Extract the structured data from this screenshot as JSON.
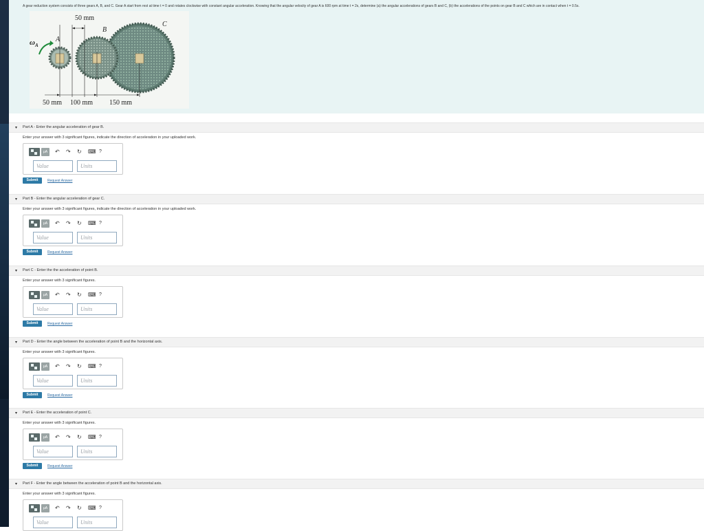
{
  "problem": {
    "text": "A gear reduction system consists of three gears A, B, and C. Gear A start from rest at time t = 0 and rotates clockwise with constant angular acceleration. Knowing that the angular velocity of gear A is 600 rpm at time t = 2s, determine (a) the angular accelerations of gears B and C, (b) the accelerations of the points on gear B and C which are in contact when t = 0.5s.",
    "figure": {
      "label_omega": "ω",
      "label_omega_sub": "A",
      "label_A": "A",
      "label_B": "B",
      "label_C": "C",
      "dim_top": "50 mm",
      "dim_bottom_1": "50 mm",
      "dim_bottom_2": "100 mm",
      "dim_bottom_3": "150 mm"
    }
  },
  "toolbar": {
    "mu_label": "μA",
    "undo_glyph": "↶",
    "redo_glyph": "↷",
    "reset_glyph": "↻",
    "help_glyph": "?"
  },
  "parts": [
    {
      "title": "Part A - Enter the angular acceleration of gear B.",
      "instructions": "Enter your answer with 3 significant figures, indicate the direction of acceleration in your uploaded work.",
      "value_placeholder": "Value",
      "units_placeholder": "Units",
      "submit": "Submit",
      "request": "Request Answer"
    },
    {
      "title": "Part B - Enter the angular acceleration of gear C.",
      "instructions": "Enter your answer with 3 significant figures, indicate the direction of acceleration in your uploaded work.",
      "value_placeholder": "Value",
      "units_placeholder": "Units",
      "submit": "Submit",
      "request": "Request Answer"
    },
    {
      "title": "Part C - Enter the the acceleration of point B.",
      "instructions": "Enter your answer with 3 significant figures.",
      "value_placeholder": "Value",
      "units_placeholder": "Units",
      "submit": "Submit",
      "request": "Request Answer"
    },
    {
      "title": "Part D - Enter the angle between the acceleration of point B and the horizontal axis.",
      "instructions": "Enter your answer with 3 significant figures.",
      "value_placeholder": "Value",
      "units_placeholder": "Units",
      "submit": "Submit",
      "request": "Request Answer"
    },
    {
      "title": "Part E - Enter the acceleration of point C.",
      "instructions": "Enter your answer with 3 significant figures.",
      "value_placeholder": "Value",
      "units_placeholder": "Units",
      "submit": "Submit",
      "request": "Request Answer"
    },
    {
      "title": "Part F - Enter the angle between the acceleration of point B and the horizontal axis.",
      "instructions": "Enter your answer with 3 significant figures.",
      "value_placeholder": "Value",
      "units_placeholder": "Units"
    }
  ]
}
